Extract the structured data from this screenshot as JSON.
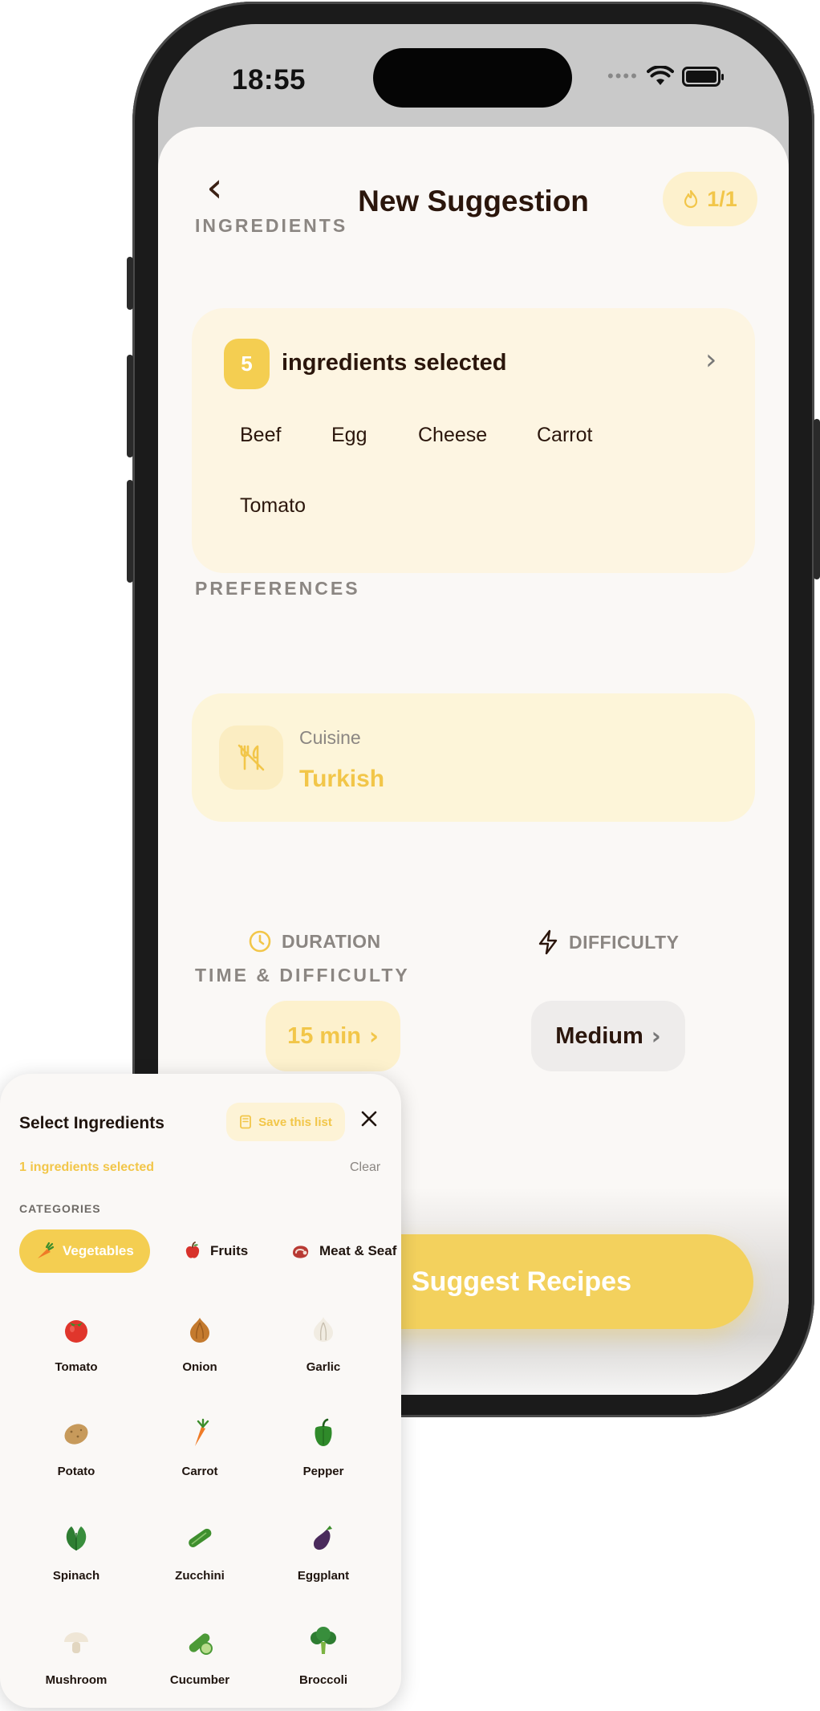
{
  "status_bar": {
    "time": "18:55",
    "signal": "••••"
  },
  "nav": {
    "back": "‹",
    "title": "New Suggestion",
    "credits": "1/1"
  },
  "ingredients": {
    "section_label": "INGREDIENTS",
    "count": "5",
    "count_label": "ingredients selected",
    "chips": [
      "Beef",
      "Egg",
      "Cheese",
      "Carrot",
      "Tomato"
    ]
  },
  "preferences": {
    "section_label": "PREFERENCES",
    "cuisine_label": "Cuisine",
    "cuisine_value": "Turkish"
  },
  "time_difficulty": {
    "section_label": "TIME & DIFFICULTY",
    "duration_label": "DURATION",
    "duration_value": "15 min",
    "difficulty_label": "DIFFICULTY",
    "difficulty_value": "Medium"
  },
  "cta": {
    "label": "Suggest Recipes"
  },
  "picker": {
    "title": "Select Ingredients",
    "save_label": "Save this list",
    "selected_text": "1 ingredients selected",
    "clear_label": "Clear",
    "categories_label": "CATEGORIES",
    "categories": [
      {
        "label": "Vegetables",
        "icon": "carrot-icon",
        "active": true
      },
      {
        "label": "Fruits",
        "icon": "apple-icon",
        "active": false
      },
      {
        "label": "Meat & Seaf",
        "icon": "meat-icon",
        "active": false
      }
    ],
    "items": [
      {
        "label": "Tomato",
        "icon": "tomato-icon"
      },
      {
        "label": "Onion",
        "icon": "onion-icon"
      },
      {
        "label": "Garlic",
        "icon": "garlic-icon"
      },
      {
        "label": "Potato",
        "icon": "potato-icon"
      },
      {
        "label": "Carrot",
        "icon": "carrot-icon"
      },
      {
        "label": "Pepper",
        "icon": "pepper-icon"
      },
      {
        "label": "Spinach",
        "icon": "spinach-icon"
      },
      {
        "label": "Zucchini",
        "icon": "zucchini-icon"
      },
      {
        "label": "Eggplant",
        "icon": "eggplant-icon"
      },
      {
        "label": "Mushroom",
        "icon": "mushroom-icon"
      },
      {
        "label": "Cucumber",
        "icon": "cucumber-icon"
      },
      {
        "label": "Broccoli",
        "icon": "broccoli-icon"
      }
    ]
  },
  "colors": {
    "accent": "#f4ce51",
    "accent_light": "#fdf5e2",
    "text": "#2b160c",
    "muted": "#8b8682",
    "background": "#faf8f6"
  }
}
